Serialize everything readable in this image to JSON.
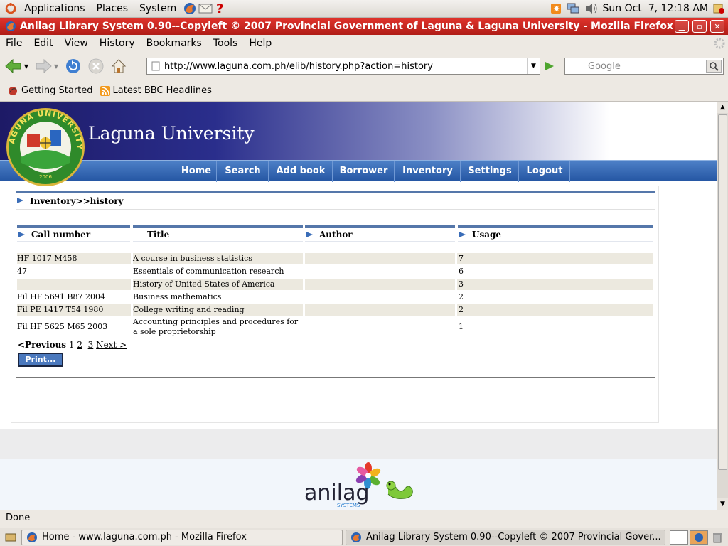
{
  "gnome_panel": {
    "menus": [
      "Applications",
      "Places",
      "System"
    ],
    "clock": "Sun Oct  7, 12:18 AM"
  },
  "window": {
    "title": "Anilag Library System 0.90--Copyleft © 2007 Provincial Government of Laguna & Laguna University - Mozilla Firefox"
  },
  "menubar": [
    "File",
    "Edit",
    "View",
    "History",
    "Bookmarks",
    "Tools",
    "Help"
  ],
  "navigation": {
    "url": "http://www.laguna.com.ph/elib/history.php?action=history",
    "search_placeholder": "Google"
  },
  "bookmarks": [
    "Getting Started",
    "Latest BBC Headlines"
  ],
  "site": {
    "title": "Laguna University",
    "logo_text": "LAGUNA UNIVERSITY",
    "logo_year": "2006",
    "nav": [
      "Home",
      "Search",
      "Add book",
      "Borrower",
      "Inventory",
      "Settings",
      "Logout"
    ]
  },
  "breadcrumb": {
    "link": "Inventory",
    "rest": ">>history"
  },
  "table": {
    "headers": [
      "Call number",
      "Title",
      "Author",
      "Usage"
    ],
    "rows": [
      {
        "call": "HF 1017 M458",
        "title": "A course in business statistics",
        "author": "",
        "usage": "7"
      },
      {
        "call": "47",
        "title": "Essentials of communication research",
        "author": "",
        "usage": "6"
      },
      {
        "call": "",
        "title": "History of United States of America",
        "author": "",
        "usage": "3"
      },
      {
        "call": "Fil HF 5691 B87 2004",
        "title": "Business mathematics",
        "author": "",
        "usage": "2"
      },
      {
        "call": "Fil PE 1417 T54 1980",
        "title": "College writing and reading",
        "author": "",
        "usage": "2"
      },
      {
        "call": "Fil HF 5625 M65 2003",
        "title": "Accounting principles and procedures for",
        "title2": "a sole proprietorship",
        "author": "",
        "usage": "1"
      }
    ]
  },
  "pager": {
    "prev": "<Previous",
    "pages": [
      "1",
      "2",
      "3"
    ],
    "next": "Next >"
  },
  "print_label": "Print...",
  "footer": {
    "brand": "anilag",
    "brand_sub": "SYSTEMS"
  },
  "status": "Done",
  "taskbar": [
    "Home - www.laguna.com.ph - Mozilla Firefox",
    "Anilag Library System 0.90--Copyleft © 2007 Provincial Gover..."
  ],
  "colors": {
    "title_bar": "#c8241e",
    "nav_blue": "#2f63ad",
    "header_dark": "#1d1a66",
    "row_alt": "#ece9df"
  }
}
